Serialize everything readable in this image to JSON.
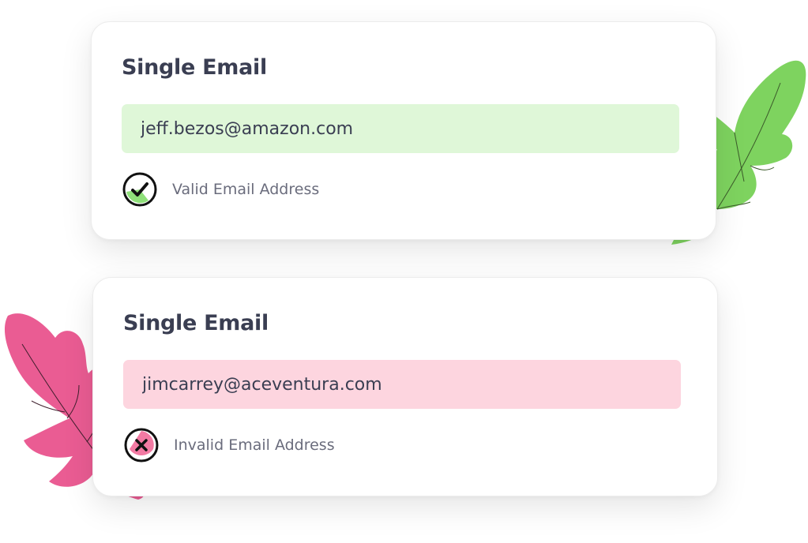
{
  "cards": [
    {
      "title": "Single Email",
      "email_value": "jeff.bezos@amazon.com",
      "status": "valid",
      "status_text": "Valid Email Address",
      "status_icon": "check-circle-icon",
      "field_color": "#dff7d8",
      "accent_color": "#7ed35f"
    },
    {
      "title": "Single Email",
      "email_value": "jimcarrey@aceventura.com",
      "status": "invalid",
      "status_text": "Invalid Email Address",
      "status_icon": "x-circle-icon",
      "field_color": "#fdd5df",
      "accent_color": "#ee6b96"
    }
  ],
  "decorations": {
    "green_leaf_color": "#7ed35f",
    "pink_leaf_color": "#ea5c93"
  }
}
